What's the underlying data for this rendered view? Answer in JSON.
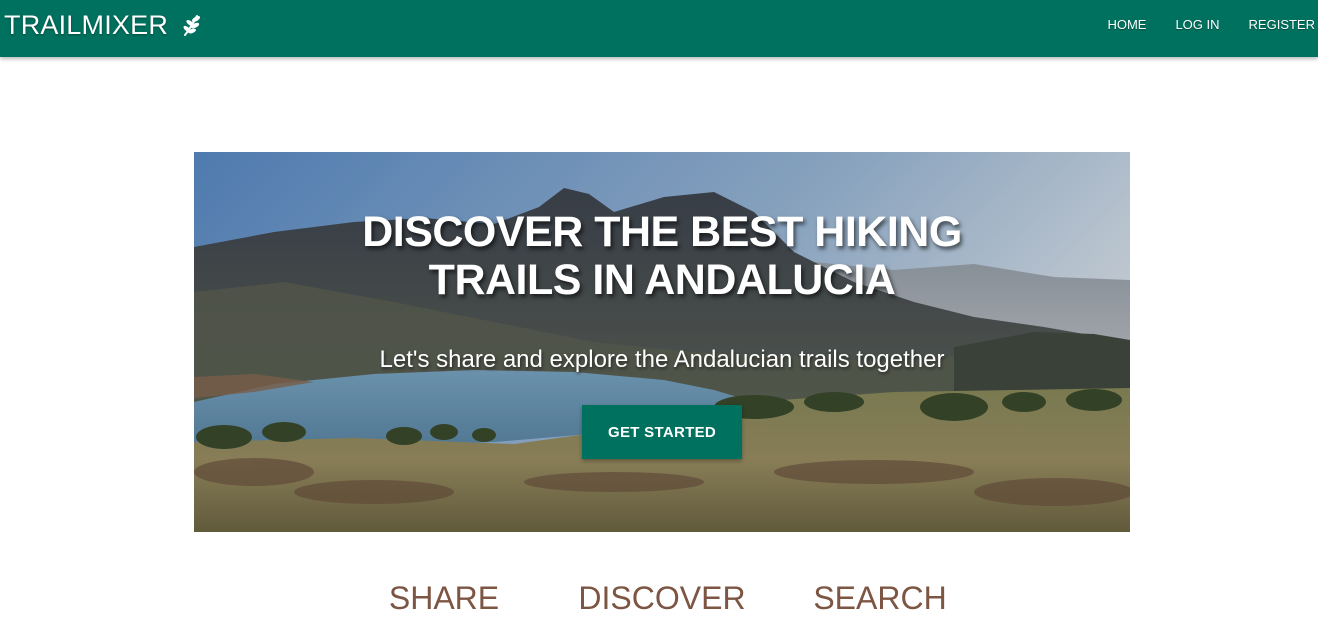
{
  "navbar": {
    "brand": "TRAILMIXER",
    "brand_icon": "leaf-sprig-icon",
    "links": [
      "HOME",
      "LOG IN",
      "REGISTER"
    ],
    "background": "#00715e"
  },
  "hero": {
    "title_line1": "DISCOVER THE BEST HIKING",
    "title_line2": "TRAILS IN ANDALUCIA",
    "subtitle": "Let's share and explore the Andalucian trails together",
    "cta_label": "GET STARTED",
    "image": "mountain-lake-landscape"
  },
  "features": {
    "titles": [
      "SHARE",
      "DISCOVER",
      "SEARCH"
    ],
    "color": "#7d5543"
  }
}
